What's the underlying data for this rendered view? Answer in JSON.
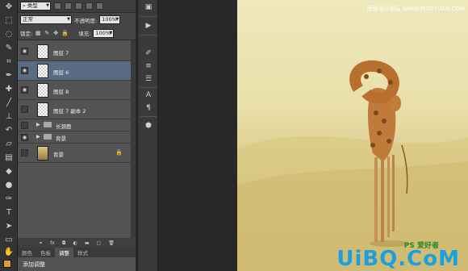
{
  "layers_panel": {
    "kind_filter": "类型",
    "blend_mode": "正常",
    "opacity_label": "不透明度:",
    "opacity_value": "100%",
    "lock_label": "锁定:",
    "fill_label": "填充:",
    "fill_value": "100%",
    "layers": [
      {
        "name": "图层 7",
        "selected": false,
        "visible": true
      },
      {
        "name": "图层 6",
        "selected": true,
        "visible": true
      },
      {
        "name": "图层 8",
        "selected": false,
        "visible": true
      },
      {
        "name": "图层 7 副本 2",
        "selected": false,
        "visible": false
      }
    ],
    "groups": [
      {
        "name": "长颈鹿"
      },
      {
        "name": "背景"
      }
    ],
    "background_layer": {
      "name": "背景"
    },
    "tabs": [
      "颜色",
      "色板",
      "调整",
      "样式"
    ],
    "active_tab": "调整",
    "add_adjustment_label": "添加调整"
  },
  "canvas": {
    "watermark_text": "思缘设计论坛 WWW.MISSYUAN.COM",
    "logo_text": "UiBQ.CoM",
    "logo_overlay": "PS 爱好者"
  },
  "colors": {
    "accent_selected": "#5a6b84",
    "foreground_swatch": "#e29c32",
    "logo_blue": "#1aa0e0"
  }
}
